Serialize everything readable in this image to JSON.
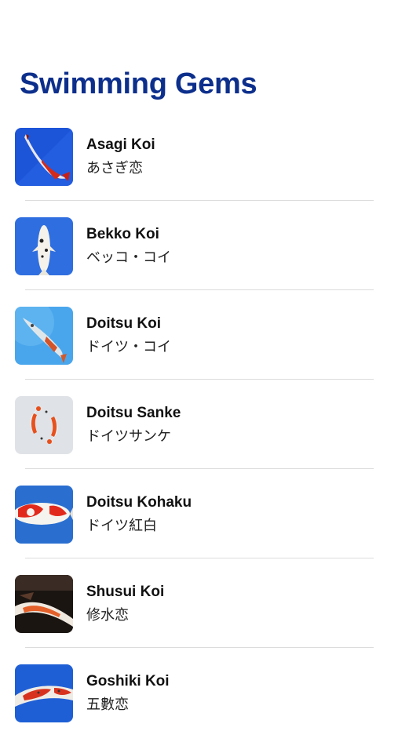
{
  "header": {
    "title": "Swimming Gems"
  },
  "items": [
    {
      "name": "Asagi Koi",
      "japanese": "あさぎ恋",
      "image": "asagi-koi-photo"
    },
    {
      "name": "Bekko Koi",
      "japanese": "ベッコ・コイ",
      "image": "bekko-koi-photo"
    },
    {
      "name": "Doitsu Koi",
      "japanese": "ドイツ・コイ",
      "image": "doitsu-koi-photo"
    },
    {
      "name": "Doitsu Sanke",
      "japanese": "ドイツサンケ",
      "image": "doitsu-sanke-photo"
    },
    {
      "name": "Doitsu Kohaku",
      "japanese": "ドイツ紅白",
      "image": "doitsu-kohaku-photo"
    },
    {
      "name": "Shusui Koi",
      "japanese": "修水恋",
      "image": "shusui-koi-photo"
    },
    {
      "name": "Goshiki Koi",
      "japanese": "五數恋",
      "image": "goshiki-koi-photo"
    }
  ]
}
